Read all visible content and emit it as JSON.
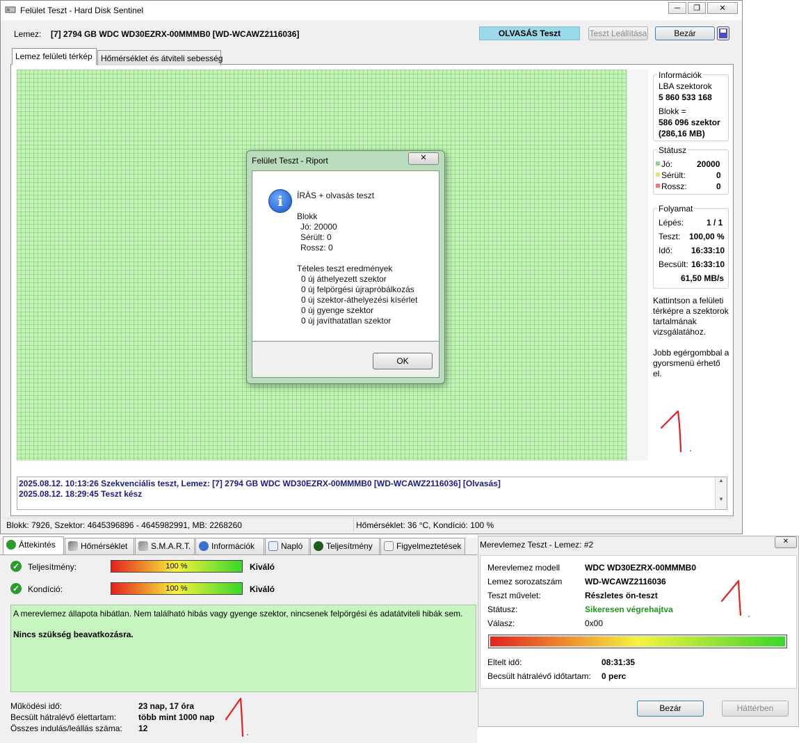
{
  "window": {
    "title": "Felület Teszt - Hard Disk Sentinel",
    "min": "─",
    "max": "❐",
    "close": "✕"
  },
  "toolbar": {
    "disk_label": "Lemez:",
    "disk_value": "[7] 2794 GB  WDC WD30EZRX-00MMMB0 [WD-WCAWZ2116036]",
    "mode_badge": "OLVASÁS Teszt",
    "stop_label": "Teszt Leállítása",
    "close_label": "Bezár"
  },
  "tabs": [
    {
      "label": "Lemez felületi térkép",
      "active": true
    },
    {
      "label": "Hőmérséklet és átviteli sebesség",
      "active": false
    }
  ],
  "info_panel": {
    "info": {
      "title": "Információk",
      "lba_label": "LBA szektorok",
      "lba_value": "5 860 533 168",
      "block_label": "Blokk =",
      "block_value": "586 096 szektor",
      "block_mb": "(286,16 MB)"
    },
    "status": {
      "title": "Státusz",
      "good_label": "Jó:",
      "good_value": "20000",
      "damaged_label": "Sérült:",
      "damaged_value": "0",
      "bad_label": "Rossz:",
      "bad_value": "0",
      "colors": {
        "good": "#8fd889",
        "damaged": "#e7e07a",
        "bad": "#e77c7c"
      }
    },
    "progress": {
      "title": "Folyamat",
      "step_label": "Lépés:",
      "step_value": "1 / 1",
      "test_label": "Teszt:",
      "test_value": "100,00 %",
      "time_label": "Idő:",
      "time_value": "16:33:10",
      "est_label": "Becsült:",
      "est_value": "16:33:10",
      "speed_value": "61,50 MB/s"
    },
    "hint1": [
      "Kattintson a felületi",
      "térképre a szektorok",
      "tartalmának",
      "vizsgálatához."
    ],
    "hint2": [
      "Jobb egérgombbal a",
      "gyorsmenü érhető",
      "el."
    ]
  },
  "log": [
    "2025.08.12.  10:13:26   Szekvenciális teszt, Lemez: [7] 2794 GB  WDC WD30EZRX-00MMMB0 [WD-WCAWZ2116036] [Olvasás]",
    "2025.08.12.  18:29:45   Teszt kész"
  ],
  "statusbar": {
    "left": "Blokk: 7926, Szektor: 4645396896 - 4645982991, MB: 2268260",
    "right": "Hőmérséklet: 36  °C,  Kondíció: 100 %"
  },
  "report_dialog": {
    "title": "Felület Teszt - Riport",
    "heading": "ÍRÁS + olvasás teszt",
    "block_title": "Blokk",
    "good": "Jó: 20000",
    "damaged": "Sérült: 0",
    "bad": "Rossz: 0",
    "batch_title": "Tételes teszt eredmények",
    "items": [
      "0 új áthelyezett szektor",
      "0 új felpörgési újrapróbálkozás",
      "0 új szektor-áthelyezési kísérlet",
      "0 új gyenge szektor",
      "0 új javíthatatlan szektor"
    ],
    "ok_label": "OK"
  },
  "overview": {
    "tabs": [
      "Áttekintés",
      "Hőmérséklet",
      "S.M.A.R.T.",
      "Információk",
      "Napló",
      "Teljesítmény",
      "Figyelmeztetések"
    ],
    "performance_label": "Teljesítmény:",
    "performance_value": "100 %",
    "performance_percent": 100,
    "performance_rating": "Kiváló",
    "condition_label": "Kondíció:",
    "condition_value": "100 %",
    "condition_percent": 100,
    "condition_rating": "Kiváló",
    "health_text": "A merevlemez állapota hibátlan. Nem található hibás vagy gyenge szektor, nincsenek felpörgési és adatátviteli hibák sem.",
    "action_text": "Nincs szükség beavatkozásra.",
    "uptime_label": "Működési idő:",
    "uptime_value": "23 nap, 17 óra",
    "lifetime_label": "Becsült hátralévő élettartam:",
    "lifetime_value": "több mint 1000 nap",
    "starts_label": "Összes indulás/leállás száma:",
    "starts_value": "12"
  },
  "hdd_test_dialog": {
    "title": "Merevlemez Teszt - Lemez: #2",
    "close_x": "✕",
    "model_label": "Merevlemez modell",
    "model_value": "WDC WD30EZRX-00MMMB0",
    "serial_label": "Lemez sorozatszám",
    "serial_value": "WD-WCAWZ2116036",
    "op_label": "Teszt művelet:",
    "op_value": "Részletes ön-teszt",
    "status_label": "Státusz:",
    "status_value": "Sikeresen végrehajtva",
    "status_color": "#1e9a1e",
    "response_label": "Válasz:",
    "response_value": "0x00",
    "progress_percent": 100,
    "elapsed_label": "Eltelt idő:",
    "elapsed_value": "08:31:35",
    "remaining_label": "Becsült hátralévő időtartam:",
    "remaining_value": "0 perc",
    "close_label": "Bezár",
    "background_label": "Háttérben"
  }
}
